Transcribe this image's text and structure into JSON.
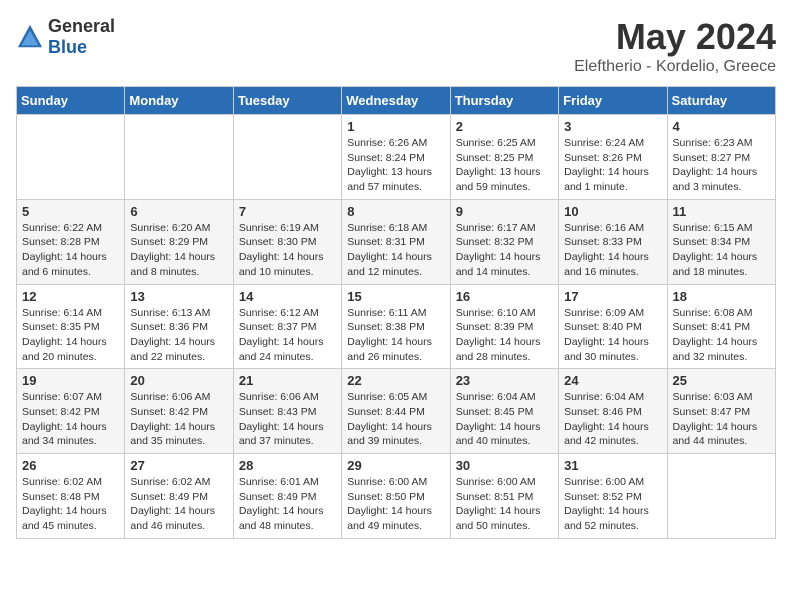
{
  "logo": {
    "general": "General",
    "blue": "Blue"
  },
  "title": "May 2024",
  "subtitle": "Eleftherio - Kordelio, Greece",
  "weekdays": [
    "Sunday",
    "Monday",
    "Tuesday",
    "Wednesday",
    "Thursday",
    "Friday",
    "Saturday"
  ],
  "weeks": [
    [
      {
        "day": "",
        "sunrise": "",
        "sunset": "",
        "daylight": ""
      },
      {
        "day": "",
        "sunrise": "",
        "sunset": "",
        "daylight": ""
      },
      {
        "day": "",
        "sunrise": "",
        "sunset": "",
        "daylight": ""
      },
      {
        "day": "1",
        "sunrise": "Sunrise: 6:26 AM",
        "sunset": "Sunset: 8:24 PM",
        "daylight": "Daylight: 13 hours and 57 minutes."
      },
      {
        "day": "2",
        "sunrise": "Sunrise: 6:25 AM",
        "sunset": "Sunset: 8:25 PM",
        "daylight": "Daylight: 13 hours and 59 minutes."
      },
      {
        "day": "3",
        "sunrise": "Sunrise: 6:24 AM",
        "sunset": "Sunset: 8:26 PM",
        "daylight": "Daylight: 14 hours and 1 minute."
      },
      {
        "day": "4",
        "sunrise": "Sunrise: 6:23 AM",
        "sunset": "Sunset: 8:27 PM",
        "daylight": "Daylight: 14 hours and 3 minutes."
      }
    ],
    [
      {
        "day": "5",
        "sunrise": "Sunrise: 6:22 AM",
        "sunset": "Sunset: 8:28 PM",
        "daylight": "Daylight: 14 hours and 6 minutes."
      },
      {
        "day": "6",
        "sunrise": "Sunrise: 6:20 AM",
        "sunset": "Sunset: 8:29 PM",
        "daylight": "Daylight: 14 hours and 8 minutes."
      },
      {
        "day": "7",
        "sunrise": "Sunrise: 6:19 AM",
        "sunset": "Sunset: 8:30 PM",
        "daylight": "Daylight: 14 hours and 10 minutes."
      },
      {
        "day": "8",
        "sunrise": "Sunrise: 6:18 AM",
        "sunset": "Sunset: 8:31 PM",
        "daylight": "Daylight: 14 hours and 12 minutes."
      },
      {
        "day": "9",
        "sunrise": "Sunrise: 6:17 AM",
        "sunset": "Sunset: 8:32 PM",
        "daylight": "Daylight: 14 hours and 14 minutes."
      },
      {
        "day": "10",
        "sunrise": "Sunrise: 6:16 AM",
        "sunset": "Sunset: 8:33 PM",
        "daylight": "Daylight: 14 hours and 16 minutes."
      },
      {
        "day": "11",
        "sunrise": "Sunrise: 6:15 AM",
        "sunset": "Sunset: 8:34 PM",
        "daylight": "Daylight: 14 hours and 18 minutes."
      }
    ],
    [
      {
        "day": "12",
        "sunrise": "Sunrise: 6:14 AM",
        "sunset": "Sunset: 8:35 PM",
        "daylight": "Daylight: 14 hours and 20 minutes."
      },
      {
        "day": "13",
        "sunrise": "Sunrise: 6:13 AM",
        "sunset": "Sunset: 8:36 PM",
        "daylight": "Daylight: 14 hours and 22 minutes."
      },
      {
        "day": "14",
        "sunrise": "Sunrise: 6:12 AM",
        "sunset": "Sunset: 8:37 PM",
        "daylight": "Daylight: 14 hours and 24 minutes."
      },
      {
        "day": "15",
        "sunrise": "Sunrise: 6:11 AM",
        "sunset": "Sunset: 8:38 PM",
        "daylight": "Daylight: 14 hours and 26 minutes."
      },
      {
        "day": "16",
        "sunrise": "Sunrise: 6:10 AM",
        "sunset": "Sunset: 8:39 PM",
        "daylight": "Daylight: 14 hours and 28 minutes."
      },
      {
        "day": "17",
        "sunrise": "Sunrise: 6:09 AM",
        "sunset": "Sunset: 8:40 PM",
        "daylight": "Daylight: 14 hours and 30 minutes."
      },
      {
        "day": "18",
        "sunrise": "Sunrise: 6:08 AM",
        "sunset": "Sunset: 8:41 PM",
        "daylight": "Daylight: 14 hours and 32 minutes."
      }
    ],
    [
      {
        "day": "19",
        "sunrise": "Sunrise: 6:07 AM",
        "sunset": "Sunset: 8:42 PM",
        "daylight": "Daylight: 14 hours and 34 minutes."
      },
      {
        "day": "20",
        "sunrise": "Sunrise: 6:06 AM",
        "sunset": "Sunset: 8:42 PM",
        "daylight": "Daylight: 14 hours and 35 minutes."
      },
      {
        "day": "21",
        "sunrise": "Sunrise: 6:06 AM",
        "sunset": "Sunset: 8:43 PM",
        "daylight": "Daylight: 14 hours and 37 minutes."
      },
      {
        "day": "22",
        "sunrise": "Sunrise: 6:05 AM",
        "sunset": "Sunset: 8:44 PM",
        "daylight": "Daylight: 14 hours and 39 minutes."
      },
      {
        "day": "23",
        "sunrise": "Sunrise: 6:04 AM",
        "sunset": "Sunset: 8:45 PM",
        "daylight": "Daylight: 14 hours and 40 minutes."
      },
      {
        "day": "24",
        "sunrise": "Sunrise: 6:04 AM",
        "sunset": "Sunset: 8:46 PM",
        "daylight": "Daylight: 14 hours and 42 minutes."
      },
      {
        "day": "25",
        "sunrise": "Sunrise: 6:03 AM",
        "sunset": "Sunset: 8:47 PM",
        "daylight": "Daylight: 14 hours and 44 minutes."
      }
    ],
    [
      {
        "day": "26",
        "sunrise": "Sunrise: 6:02 AM",
        "sunset": "Sunset: 8:48 PM",
        "daylight": "Daylight: 14 hours and 45 minutes."
      },
      {
        "day": "27",
        "sunrise": "Sunrise: 6:02 AM",
        "sunset": "Sunset: 8:49 PM",
        "daylight": "Daylight: 14 hours and 46 minutes."
      },
      {
        "day": "28",
        "sunrise": "Sunrise: 6:01 AM",
        "sunset": "Sunset: 8:49 PM",
        "daylight": "Daylight: 14 hours and 48 minutes."
      },
      {
        "day": "29",
        "sunrise": "Sunrise: 6:00 AM",
        "sunset": "Sunset: 8:50 PM",
        "daylight": "Daylight: 14 hours and 49 minutes."
      },
      {
        "day": "30",
        "sunrise": "Sunrise: 6:00 AM",
        "sunset": "Sunset: 8:51 PM",
        "daylight": "Daylight: 14 hours and 50 minutes."
      },
      {
        "day": "31",
        "sunrise": "Sunrise: 6:00 AM",
        "sunset": "Sunset: 8:52 PM",
        "daylight": "Daylight: 14 hours and 52 minutes."
      },
      {
        "day": "",
        "sunrise": "",
        "sunset": "",
        "daylight": ""
      }
    ]
  ]
}
